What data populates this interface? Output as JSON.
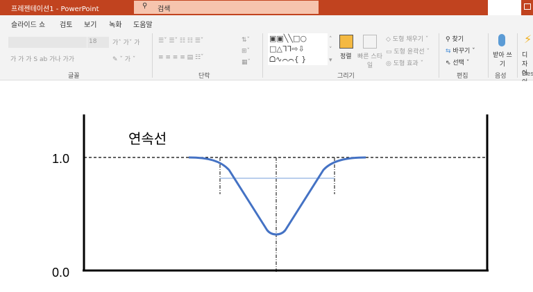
{
  "window": {
    "title": "프레젠테이션1  -  PowerPoint",
    "search_placeholder": "검색"
  },
  "tabs": [
    "슬라이드 쇼",
    "검토",
    "보기",
    "녹화",
    "도움말"
  ],
  "ribbon": {
    "font": {
      "label": "글꼴",
      "size": "18",
      "row2": "가  가  가  S  ab  가나  가가"
    },
    "paragraph": {
      "label": "단락"
    },
    "drawing": {
      "label": "그리기",
      "arrange": "정렬",
      "quick_styles": "빠른 스타일",
      "fill": "도형 채우기",
      "outline": "도형 윤곽선",
      "effects": "도형 효과"
    },
    "editing": {
      "label": "편집",
      "find": "찾기",
      "replace": "바꾸기",
      "select": "선택"
    },
    "voice": {
      "label": "음성",
      "dictate": "받아 쓰기"
    },
    "designer": {
      "label": "Desi",
      "button": "디자 아이"
    }
  },
  "diagram": {
    "title": "연속선",
    "y_labels": [
      "1.0",
      "0.0"
    ],
    "curve_color": "#4472c4"
  }
}
